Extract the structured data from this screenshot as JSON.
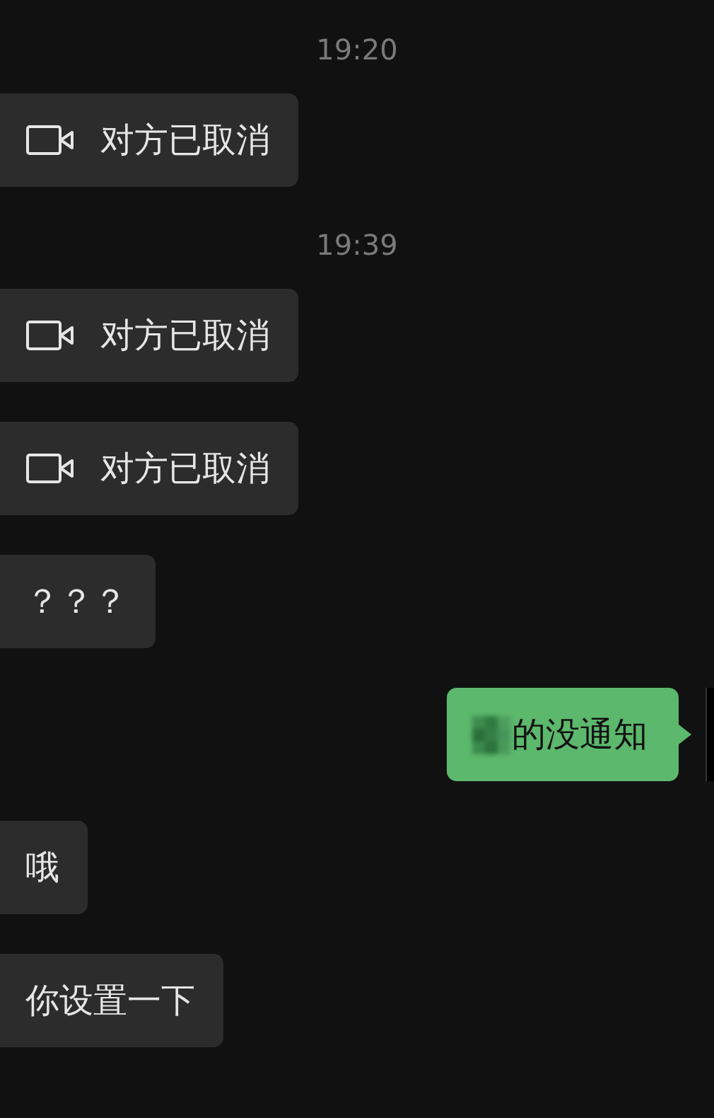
{
  "messages": [
    {
      "kind": "time",
      "text": "19:20"
    },
    {
      "kind": "call",
      "outgoing": false,
      "text": "对方已取消"
    },
    {
      "kind": "time",
      "text": "19:39"
    },
    {
      "kind": "call",
      "outgoing": false,
      "text": "对方已取消"
    },
    {
      "kind": "call",
      "outgoing": false,
      "text": "对方已取消"
    },
    {
      "kind": "text",
      "outgoing": false,
      "text": "？？？"
    },
    {
      "kind": "text",
      "outgoing": true,
      "redacted": true,
      "text": "的没通知"
    },
    {
      "kind": "text",
      "outgoing": false,
      "text": "哦"
    },
    {
      "kind": "text",
      "outgoing": false,
      "text": "你设置一下"
    }
  ]
}
